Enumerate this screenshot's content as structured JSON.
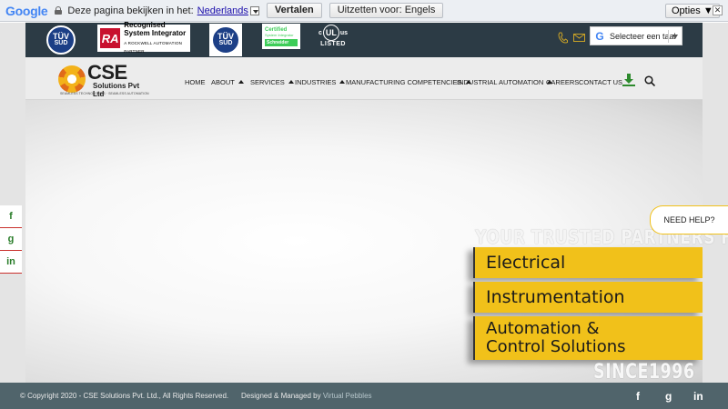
{
  "translate_bar": {
    "logo": "Google",
    "prompt": "Deze pagina bekijken in het:",
    "language": "Nederlands",
    "translate_label": "Vertalen",
    "off_label": "Uitzetten voor: Engels",
    "options_label": "Opties ▼",
    "close_label": "✕"
  },
  "header": {
    "certs": {
      "tuv1_top": "TÜV",
      "tuv1_bottom": "SÜD",
      "ra_logo": "RA",
      "ra_line1": "Recognised",
      "ra_line2": "System Integrator",
      "ra_sub": "A ROCKWELL AUTOMATION PARTNER",
      "tuv2_top": "TÜV",
      "tuv2_bottom": "SÜD",
      "se_line1": "Certified",
      "se_line2": "System Integrator",
      "se_brand": "Schneider",
      "ul_c": "c",
      "ul_mark": "UL",
      "ul_us": "us",
      "ul_listed": "LISTED"
    },
    "language_select": "Selecteer een taal"
  },
  "logo": {
    "name": "CSE",
    "sub": "Solutions Pvt Ltd",
    "tagline": "SEAMLESS TECHNOLOGIES · SEAMLESS AUTOMATION"
  },
  "nav": {
    "home": "HOME",
    "about": "ABOUT",
    "services": "SERVICES",
    "industries": "INDUSTRIES",
    "manufacturing": "MANUFACTURING COMPETENCIES",
    "automation": "INDUSTRIAL AUTOMATION",
    "careers": "CAREERS",
    "contact": "CONTACT US"
  },
  "hero": {
    "title": "YOUR TRUSTED PARTNERS FOR",
    "item1": "Electrical",
    "item2": "Instrumentation",
    "item3_line1": "Automation &",
    "item3_line2": "Control Solutions",
    "since": "SINCE1996"
  },
  "need_help": "NEED HELP?",
  "side_share": {
    "facebook": "f",
    "google": "g",
    "linkedin": "in"
  },
  "footer": {
    "copyright": "© Copyright 2020 - CSE Solutions Pvt. Ltd., All Rights Reserved.",
    "designed_prefix": "Designed & Managed by",
    "designer": "Virtual Pebbles",
    "facebook": "f",
    "google": "g",
    "linkedin": "in"
  },
  "colors": {
    "accent_yellow": "#f1c11a",
    "header_dark": "#2c3b45",
    "footer": "#50646b"
  }
}
